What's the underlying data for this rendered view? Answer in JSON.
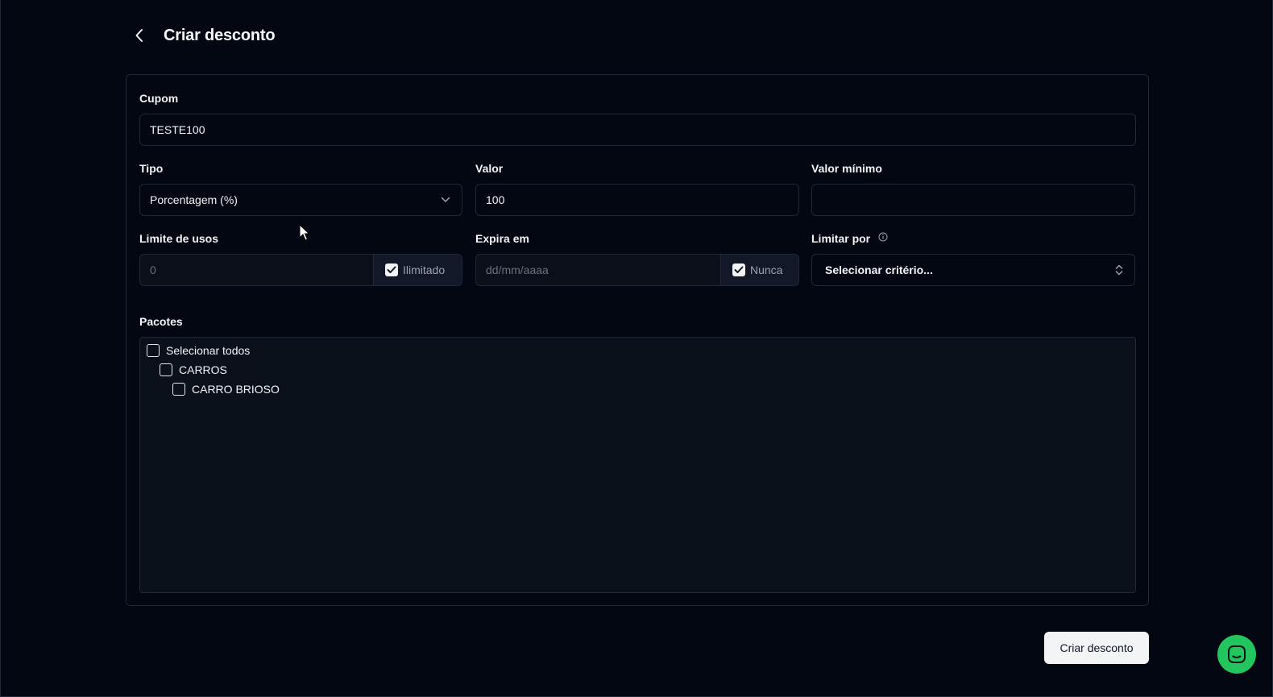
{
  "header": {
    "title": "Criar desconto"
  },
  "form": {
    "coupon": {
      "label": "Cupom",
      "value": "TESTE100"
    },
    "type": {
      "label": "Tipo",
      "value": "Porcentagem (%)"
    },
    "amount": {
      "label": "Valor",
      "value": "100"
    },
    "min_amount": {
      "label": "Valor mínimo",
      "value": ""
    },
    "usage_limit": {
      "label": "Limite de usos",
      "value": "0",
      "unlimited_label": "Ilimitado",
      "unlimited_checked": true
    },
    "expires": {
      "label": "Expira em",
      "placeholder": "dd/mm/aaaa",
      "never_label": "Nunca",
      "never_checked": true
    },
    "limit_by": {
      "label": "Limitar por",
      "value": "Selecionar critério..."
    },
    "packages": {
      "label": "Pacotes",
      "items": [
        {
          "label": "Selecionar todos",
          "checked": false
        },
        {
          "label": "CARROS",
          "checked": false
        },
        {
          "label": "CARRO BRIOSO",
          "checked": false
        }
      ]
    }
  },
  "actions": {
    "submit_label": "Criar desconto"
  },
  "colors": {
    "background": "#030712",
    "accent_chat": "#22c55e",
    "button_bg": "#f3f4f6"
  }
}
